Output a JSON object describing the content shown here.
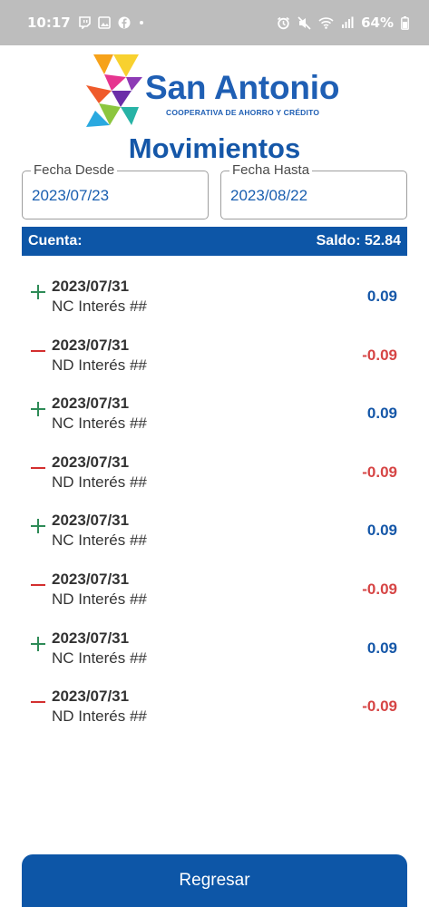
{
  "status_bar": {
    "time": "10:17",
    "battery": "64%",
    "left_icons": [
      "twitch-icon",
      "image-icon",
      "facebook-icon",
      "dot-icon"
    ],
    "right_icons": [
      "alarm-icon",
      "mute-icon",
      "wifi-icon",
      "signal-icon",
      "battery-icon"
    ]
  },
  "brand": {
    "name": "San Antonio",
    "tagline": "COOPERATIVA DE AHORRO Y CRÉDITO"
  },
  "page": {
    "title": "Movimientos"
  },
  "filters": {
    "from": {
      "label": "Fecha Desde",
      "value": "2023/07/23"
    },
    "to": {
      "label": "Fecha Hasta",
      "value": "2023/08/22"
    }
  },
  "account": {
    "label": "Cuenta:",
    "balance": "Saldo: 52.84"
  },
  "movements": [
    {
      "type": "credit",
      "date": "2023/07/31",
      "description": "NC Interés ##",
      "amount": "0.09"
    },
    {
      "type": "debit",
      "date": "2023/07/31",
      "description": "ND Interés ##",
      "amount": "-0.09"
    },
    {
      "type": "credit",
      "date": "2023/07/31",
      "description": "NC Interés ##",
      "amount": "0.09"
    },
    {
      "type": "debit",
      "date": "2023/07/31",
      "description": "ND Interés ##",
      "amount": "-0.09"
    },
    {
      "type": "credit",
      "date": "2023/07/31",
      "description": "NC Interés ##",
      "amount": "0.09"
    },
    {
      "type": "debit",
      "date": "2023/07/31",
      "description": "ND Interés ##",
      "amount": "-0.09"
    },
    {
      "type": "credit",
      "date": "2023/07/31",
      "description": "NC Interés ##",
      "amount": "0.09"
    },
    {
      "type": "debit",
      "date": "2023/07/31",
      "description": "ND Interés ##",
      "amount": "-0.09"
    }
  ],
  "actions": {
    "back_label": "Regresar"
  },
  "colors": {
    "primary": "#0d56a7",
    "title": "#1557a8",
    "credit_sign": "#2e8b57",
    "debit_sign": "#d32f2f",
    "debit_amount": "#d64545"
  }
}
